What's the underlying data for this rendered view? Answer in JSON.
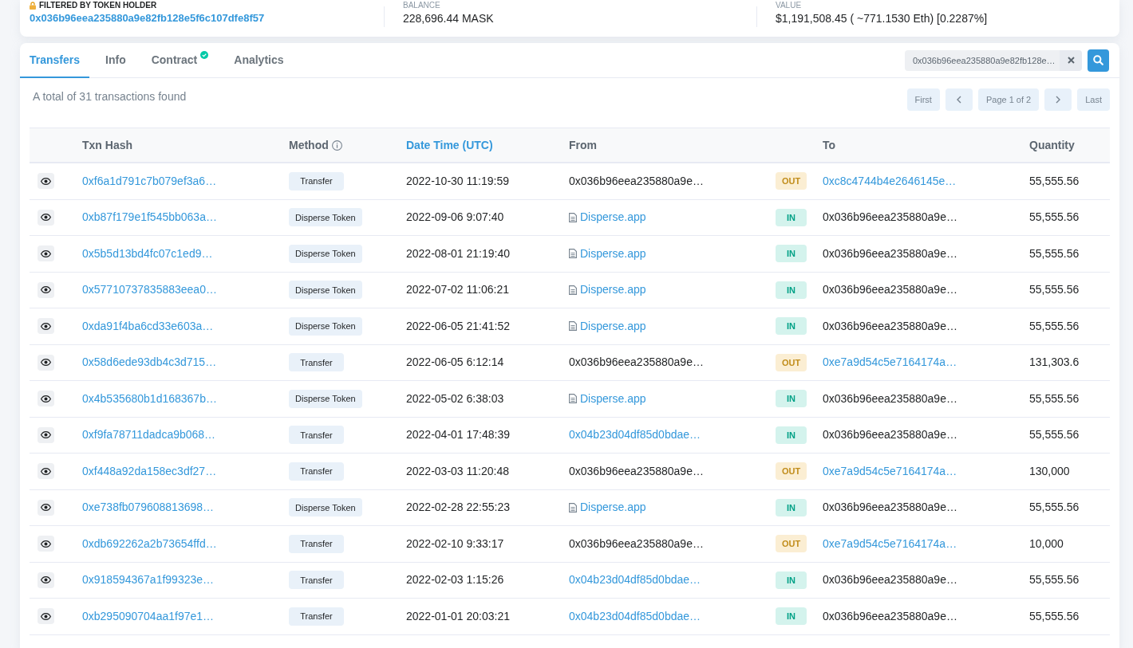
{
  "holder": {
    "label": "FILTERED BY TOKEN HOLDER",
    "address": "0x036b96eea235880a9e82fb128e5f6c107dfe8f57"
  },
  "balance": {
    "label": "BALANCE",
    "value": "228,696.44 MASK"
  },
  "value": {
    "label": "VALUE",
    "value": "$1,191,508.45 ( ~771.1530 Eth) [0.2287%]"
  },
  "tabs": [
    {
      "label": "Transfers",
      "selected": true,
      "verified": false
    },
    {
      "label": "Info",
      "selected": false,
      "verified": false
    },
    {
      "label": "Contract",
      "selected": false,
      "verified": true
    },
    {
      "label": "Analytics",
      "selected": false,
      "verified": false
    }
  ],
  "search": {
    "value": "0x036b96eea235880a9e82fb128e…"
  },
  "summary": "A total of 31 transactions found",
  "pagination": {
    "first": "First",
    "page": "Page 1 of 2",
    "last": "Last"
  },
  "table": {
    "columns": [
      {
        "label": "Txn Hash",
        "kind": "text"
      },
      {
        "label": "Method",
        "kind": "info"
      },
      {
        "label": "Date Time (UTC)",
        "kind": "sorted"
      },
      {
        "label": "From",
        "kind": "text"
      },
      {
        "label": "To",
        "kind": "text"
      },
      {
        "label": "Quantity",
        "kind": "text"
      }
    ],
    "rows": [
      {
        "hash": "0xf6a1d791c7b079ef3a6…",
        "method": "Transfer",
        "time": "2022-10-30 11:19:59",
        "from": {
          "text": "0x036b96eea235880a9e…",
          "kind": "plain"
        },
        "direction": {
          "label": "OUT",
          "kind": "out"
        },
        "to": {
          "text": "0xc8c4744b4e2646145e…",
          "kind": "link"
        },
        "quantity": "55,555.56"
      },
      {
        "hash": "0xb87f179e1f545bb063a…",
        "method": "Disperse Token",
        "time": "2022-09-06 9:07:40",
        "from": {
          "text": "Disperse.app",
          "kind": "contract"
        },
        "direction": {
          "label": "IN",
          "kind": "in"
        },
        "to": {
          "text": "0x036b96eea235880a9e…",
          "kind": "plain"
        },
        "quantity": "55,555.56"
      },
      {
        "hash": "0x5b5d13bd4fc07c1ed9…",
        "method": "Disperse Token",
        "time": "2022-08-01 21:19:40",
        "from": {
          "text": "Disperse.app",
          "kind": "contract"
        },
        "direction": {
          "label": "IN",
          "kind": "in"
        },
        "to": {
          "text": "0x036b96eea235880a9e…",
          "kind": "plain"
        },
        "quantity": "55,555.56"
      },
      {
        "hash": "0x57710737835883eea0…",
        "method": "Disperse Token",
        "time": "2022-07-02 11:06:21",
        "from": {
          "text": "Disperse.app",
          "kind": "contract"
        },
        "direction": {
          "label": "IN",
          "kind": "in"
        },
        "to": {
          "text": "0x036b96eea235880a9e…",
          "kind": "plain"
        },
        "quantity": "55,555.56"
      },
      {
        "hash": "0xda91f4ba6cd33e603a…",
        "method": "Disperse Token",
        "time": "2022-06-05 21:41:52",
        "from": {
          "text": "Disperse.app",
          "kind": "contract"
        },
        "direction": {
          "label": "IN",
          "kind": "in"
        },
        "to": {
          "text": "0x036b96eea235880a9e…",
          "kind": "plain"
        },
        "quantity": "55,555.56"
      },
      {
        "hash": "0x58d6ede93db4c3d715…",
        "method": "Transfer",
        "time": "2022-06-05 6:12:14",
        "from": {
          "text": "0x036b96eea235880a9e…",
          "kind": "plain"
        },
        "direction": {
          "label": "OUT",
          "kind": "out"
        },
        "to": {
          "text": "0xe7a9d54c5e7164174a…",
          "kind": "link"
        },
        "quantity": "131,303.6"
      },
      {
        "hash": "0x4b535680b1d168367b…",
        "method": "Disperse Token",
        "time": "2022-05-02 6:38:03",
        "from": {
          "text": "Disperse.app",
          "kind": "contract"
        },
        "direction": {
          "label": "IN",
          "kind": "in"
        },
        "to": {
          "text": "0x036b96eea235880a9e…",
          "kind": "plain"
        },
        "quantity": "55,555.56"
      },
      {
        "hash": "0xf9fa78711dadca9b068…",
        "method": "Transfer",
        "time": "2022-04-01 17:48:39",
        "from": {
          "text": "0x04b23d04df85d0bdae…",
          "kind": "link"
        },
        "direction": {
          "label": "IN",
          "kind": "in"
        },
        "to": {
          "text": "0x036b96eea235880a9e…",
          "kind": "plain"
        },
        "quantity": "55,555.56"
      },
      {
        "hash": "0xf448a92da158ec3df27…",
        "method": "Transfer",
        "time": "2022-03-03 11:20:48",
        "from": {
          "text": "0x036b96eea235880a9e…",
          "kind": "plain"
        },
        "direction": {
          "label": "OUT",
          "kind": "out"
        },
        "to": {
          "text": "0xe7a9d54c5e7164174a…",
          "kind": "link"
        },
        "quantity": "130,000"
      },
      {
        "hash": "0xe738fb079608813698…",
        "method": "Disperse Token",
        "time": "2022-02-28 22:55:23",
        "from": {
          "text": "Disperse.app",
          "kind": "contract"
        },
        "direction": {
          "label": "IN",
          "kind": "in"
        },
        "to": {
          "text": "0x036b96eea235880a9e…",
          "kind": "plain"
        },
        "quantity": "55,555.56"
      },
      {
        "hash": "0xdb692262a2b73654ffd…",
        "method": "Transfer",
        "time": "2022-02-10 9:33:17",
        "from": {
          "text": "0x036b96eea235880a9e…",
          "kind": "plain"
        },
        "direction": {
          "label": "OUT",
          "kind": "out"
        },
        "to": {
          "text": "0xe7a9d54c5e7164174a…",
          "kind": "link"
        },
        "quantity": "10,000"
      },
      {
        "hash": "0x918594367a1f99323e…",
        "method": "Transfer",
        "time": "2022-02-03 1:15:26",
        "from": {
          "text": "0x04b23d04df85d0bdae…",
          "kind": "link"
        },
        "direction": {
          "label": "IN",
          "kind": "in"
        },
        "to": {
          "text": "0x036b96eea235880a9e…",
          "kind": "plain"
        },
        "quantity": "55,555.56"
      },
      {
        "hash": "0xb295090704aa1f97e1…",
        "method": "Transfer",
        "time": "2022-01-01 20:03:21",
        "from": {
          "text": "0x04b23d04df85d0bdae…",
          "kind": "link"
        },
        "direction": {
          "label": "IN",
          "kind": "in"
        },
        "to": {
          "text": "0x036b96eea235880a9e…",
          "kind": "plain"
        },
        "quantity": "55,555.56"
      }
    ]
  }
}
